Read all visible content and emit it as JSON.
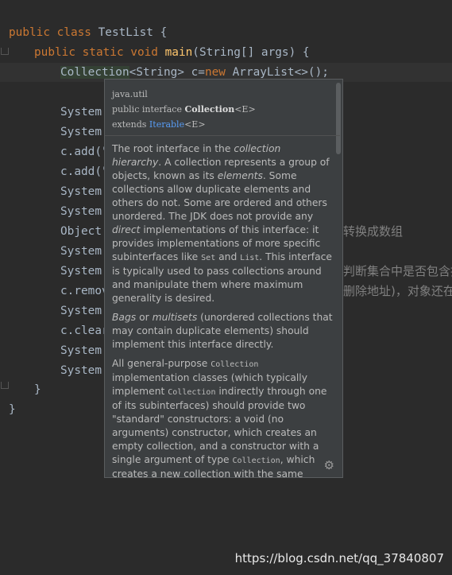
{
  "code": {
    "l1": {
      "kw": "public class ",
      "name": "TestList",
      "rest": " {"
    },
    "l2": {
      "kw1": "public static void ",
      "fn": "main",
      "rest": "(String[] args) {"
    },
    "l3": {
      "type": "Collection",
      "generic": "<String>",
      "var": " c=",
      "kw": "new",
      "rest": " ArrayList<>();"
    },
    "lines": [
      "System.",
      "System.",
      "c.add(\"",
      "c.add(\"",
      "System.",
      "System.",
      "Object[",
      "System.",
      "System.",
      "c.remov",
      "System.",
      "c.clear",
      "System.",
      "System."
    ],
    "comment1": "转换成数组",
    "comment2": "判断集合中是否包含指",
    "comment3": "删除地址)，对象还在",
    "close1": "}",
    "close2": "}"
  },
  "popup": {
    "package": "java.util",
    "sig_prefix": "public interface ",
    "sig_name": "Collection",
    "sig_generic": "<E>",
    "extends_kw": "extends ",
    "extends_link": "Iterable",
    "extends_generic": "<E>",
    "p1": {
      "a": "The root interface in the ",
      "b": "collection hierarchy",
      "c": ". A collection represents a group of objects, known as its ",
      "d": "elements",
      "e": ". Some collections allow duplicate elements and others do not. Some are ordered and others unordered. The JDK does not provide any ",
      "f": "direct",
      "g": " implementations of this interface: it provides implementations of more specific subinterfaces like ",
      "h": "Set",
      "i": " and ",
      "j": "List",
      "k": ". This interface is typically used to pass collections around and manipulate them where maximum generality is desired."
    },
    "p2": {
      "a": "Bags",
      "b": " or ",
      "c": "multisets",
      "d": " (unordered collections that may contain duplicate elements) should implement this interface directly."
    },
    "p3": {
      "a": "All general-purpose ",
      "b": "Collection",
      "c": " implementation classes (which typically implement ",
      "d": "Collection",
      "e": " indirectly through one of its subinterfaces) should provide two \"standard\" constructors: a void (no arguments) constructor, which creates an empty collection, and a constructor with a single argument of type ",
      "f": "Collection",
      "g": ", which creates a new collection with the same"
    },
    "gear_icon": "gear-icon"
  },
  "watermark": "https://blog.csdn.net/qq_37840807"
}
